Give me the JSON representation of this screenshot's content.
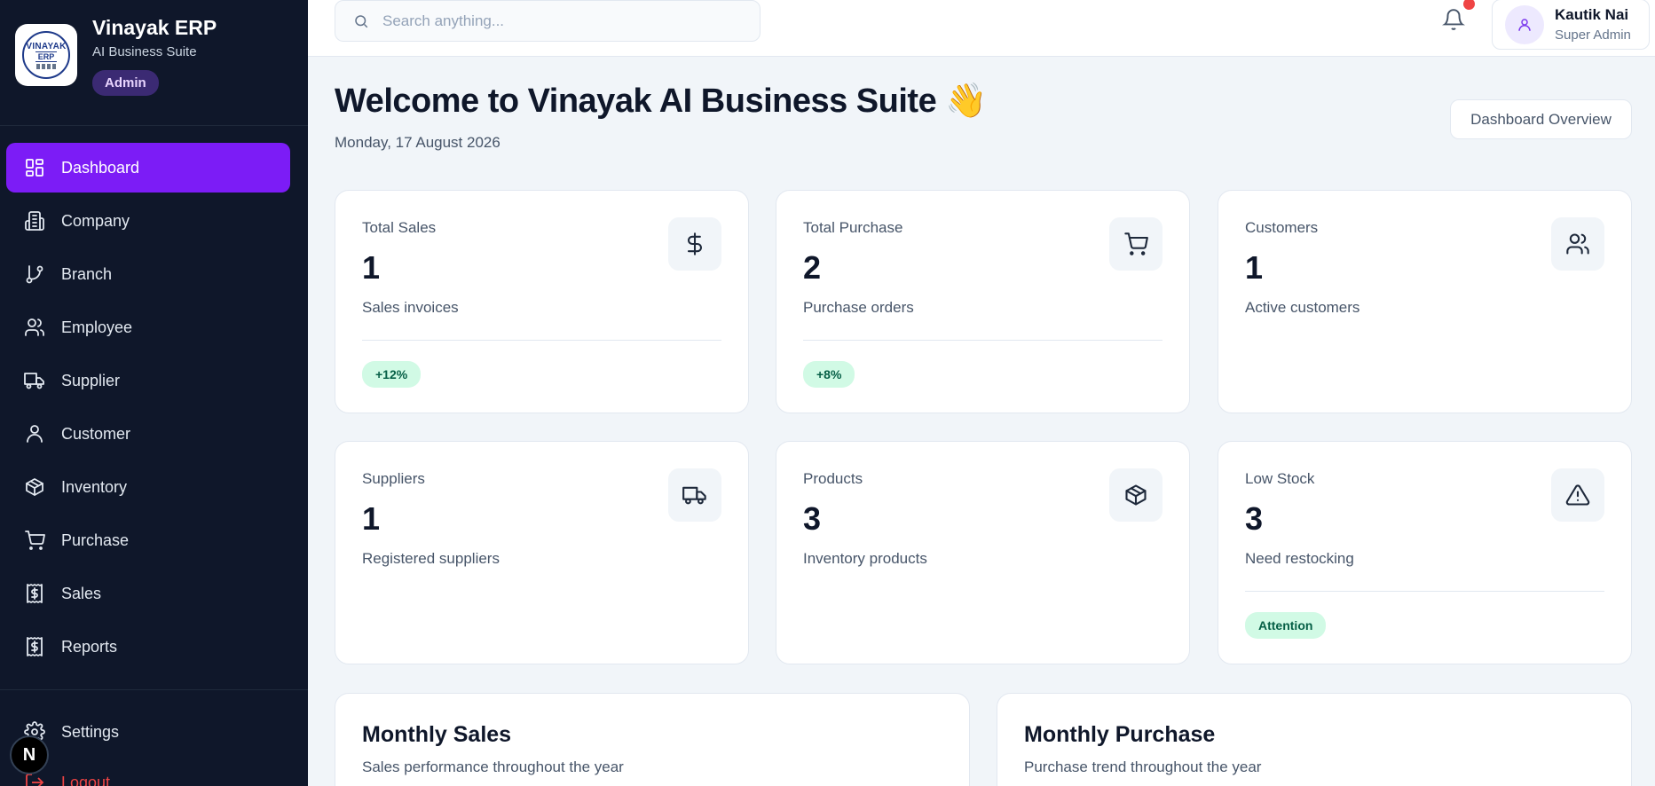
{
  "brand": {
    "logo_line1": "VINAYAK",
    "logo_line2": "ERP",
    "title": "Vinayak ERP",
    "subtitle": "AI Business Suite",
    "role_badge": "Admin"
  },
  "sidebar": {
    "items": [
      {
        "label": "Dashboard",
        "icon": "dashboard-icon",
        "active": true
      },
      {
        "label": "Company",
        "icon": "building-icon"
      },
      {
        "label": "Branch",
        "icon": "git-branch-icon"
      },
      {
        "label": "Employee",
        "icon": "users-icon"
      },
      {
        "label": "Supplier",
        "icon": "truck-icon"
      },
      {
        "label": "Customer",
        "icon": "user-icon"
      },
      {
        "label": "Inventory",
        "icon": "package-icon"
      },
      {
        "label": "Purchase",
        "icon": "cart-icon"
      },
      {
        "label": "Sales",
        "icon": "receipt-dollar-icon"
      },
      {
        "label": "Reports",
        "icon": "receipt-dollar-icon"
      }
    ],
    "settings_label": "Settings",
    "logout_label": "Logout",
    "dev_badge": "N"
  },
  "header": {
    "search_placeholder": "Search anything...",
    "user_name": "Kautik Nai",
    "user_role": "Super Admin"
  },
  "main": {
    "welcome": "Welcome to Vinayak AI Business Suite 👋",
    "date": "Monday, 17 August 2026",
    "overview_button": "Dashboard Overview"
  },
  "cards": [
    {
      "title": "Total Sales",
      "value": "1",
      "desc": "Sales invoices",
      "badge": "+12%",
      "icon": "dollar-icon"
    },
    {
      "title": "Total Purchase",
      "value": "2",
      "desc": "Purchase orders",
      "badge": "+8%",
      "icon": "cart-icon"
    },
    {
      "title": "Customers",
      "value": "1",
      "desc": "Active customers",
      "badge": "",
      "icon": "users-icon"
    },
    {
      "title": "Suppliers",
      "value": "1",
      "desc": "Registered suppliers",
      "badge": "",
      "icon": "truck-icon"
    },
    {
      "title": "Products",
      "value": "3",
      "desc": "Inventory products",
      "badge": "",
      "icon": "package-icon"
    },
    {
      "title": "Low Stock",
      "value": "3",
      "desc": "Need restocking",
      "badge": "Attention",
      "icon": "warning-icon"
    }
  ],
  "panels": [
    {
      "title": "Monthly Sales",
      "subtitle": "Sales performance throughout the year"
    },
    {
      "title": "Monthly Purchase",
      "subtitle": "Purchase trend throughout the year"
    }
  ],
  "colors": {
    "sidebar_bg": "#0f172a",
    "accent": "#7c1cf6",
    "badge_green": "#d1fae5",
    "notification": "#ef4444"
  }
}
